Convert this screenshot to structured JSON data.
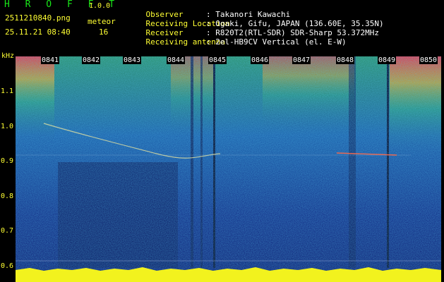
{
  "app": {
    "name": "H R O F F T",
    "version": "1.0.0"
  },
  "file": {
    "name": "2511210840.png",
    "datetime": "25.11.21 08:40"
  },
  "meteor": {
    "label": "meteor",
    "count": "16"
  },
  "info": [
    {
      "label": "Observer",
      "value": ": Takanori Kawachi"
    },
    {
      "label": "Receiving Location",
      "value": ": Ogaki, Gifu, JAPAN (136.60E, 35.35N)"
    },
    {
      "label": "Receiver",
      "value": ": R820T2(RTL-SDR) SDR-Sharp 53.372MHz"
    },
    {
      "label": "Receiving antenna",
      "value": ": 2el-HB9CV Vertical (el. E-W)"
    }
  ],
  "axis": {
    "unit": "kHz",
    "y_ticks": [
      "1.1",
      "1.0",
      "0.9",
      "0.8",
      "0.7",
      "0.6"
    ],
    "x_ticks": [
      "0841",
      "0842",
      "0843",
      "0844",
      "0845",
      "0846",
      "0847",
      "0848",
      "0849",
      "0850"
    ]
  },
  "colors": {
    "label_green": "#19e619",
    "label_yellow": "#ffff33",
    "background": "#000000"
  }
}
